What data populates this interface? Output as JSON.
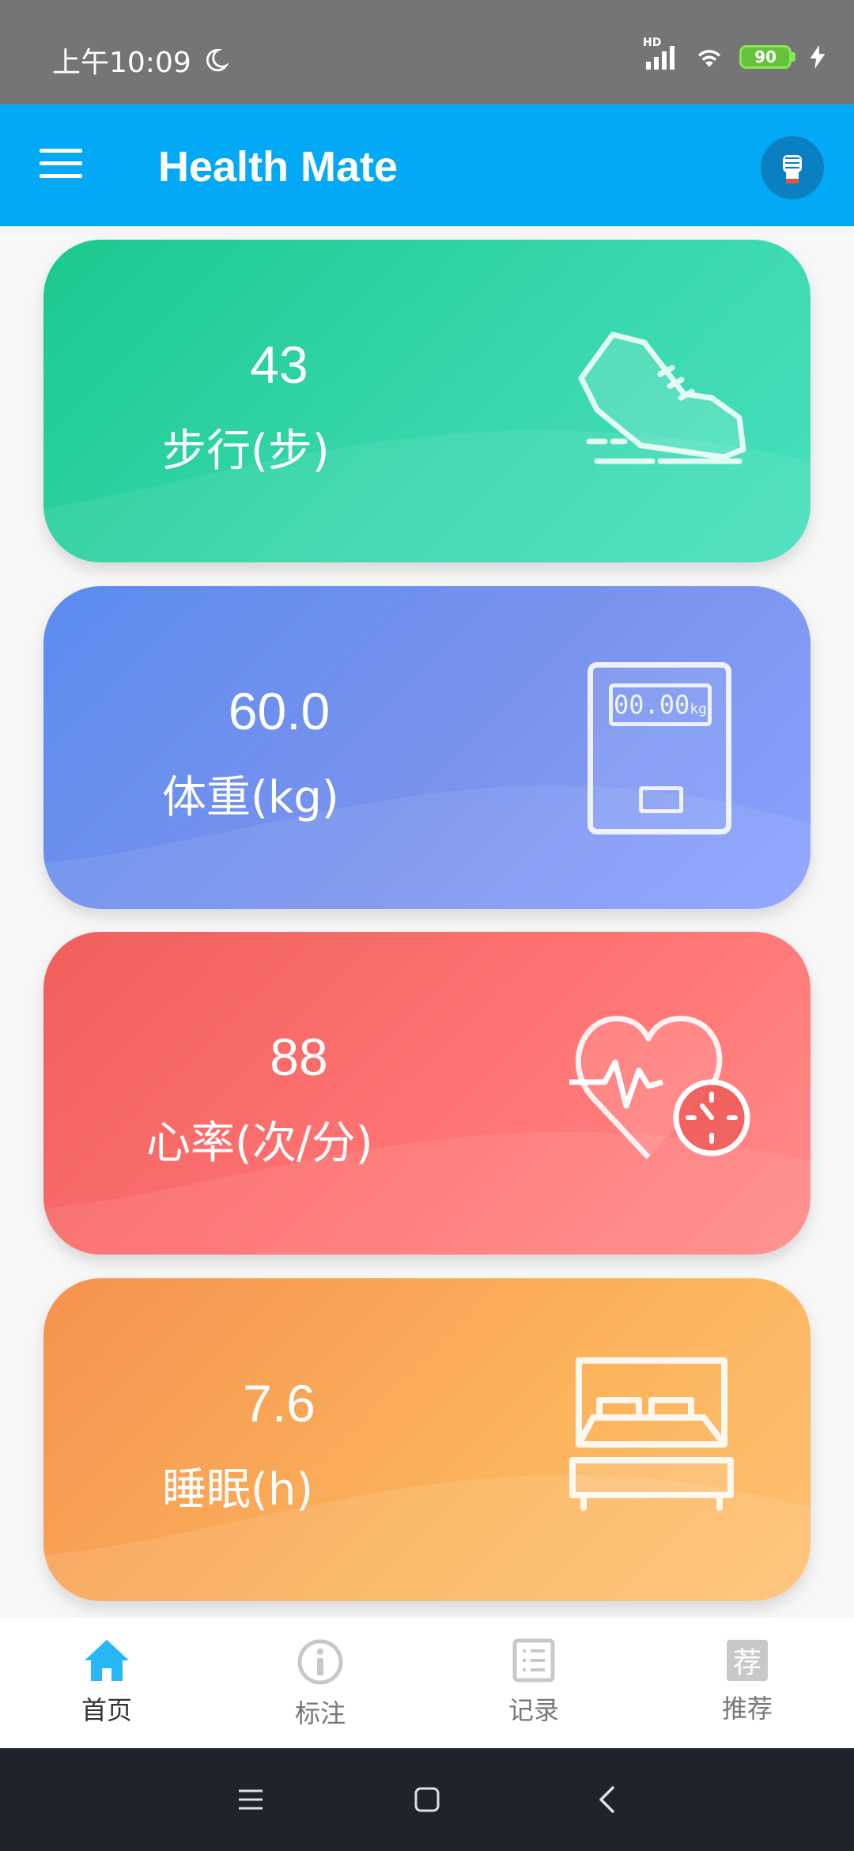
{
  "status_bar": {
    "time": "上午10:09",
    "battery": "90",
    "network_label": "HD"
  },
  "app_bar": {
    "title": "Health Mate",
    "menu_icon": "hamburger-menu-icon",
    "avatar_icon": "fist-avatar-icon"
  },
  "cards": [
    {
      "value": "43",
      "label": "步行(步)",
      "icon": "sneaker-icon",
      "color": "#1bc98f"
    },
    {
      "value": "60.0",
      "label": "体重(kg)",
      "icon": "scale-icon",
      "color": "#5b8cf0",
      "scale_display": "00.00",
      "scale_unit": "kg"
    },
    {
      "value": "88",
      "label": "心率(次/分)",
      "icon": "heart-rate-icon",
      "color": "#f05f5c"
    },
    {
      "value": "7.6",
      "label": "睡眠(h)",
      "icon": "bed-icon",
      "color": "#f6924f"
    }
  ],
  "bottom_nav": [
    {
      "label": "首页",
      "icon": "home-icon",
      "active": true
    },
    {
      "label": "标注",
      "icon": "info-icon",
      "active": false
    },
    {
      "label": "记录",
      "icon": "list-icon",
      "active": false
    },
    {
      "label": "推荐",
      "icon": "recommend-icon",
      "active": false,
      "icon_text": "荐"
    }
  ],
  "accent_color": "#03a9f4"
}
